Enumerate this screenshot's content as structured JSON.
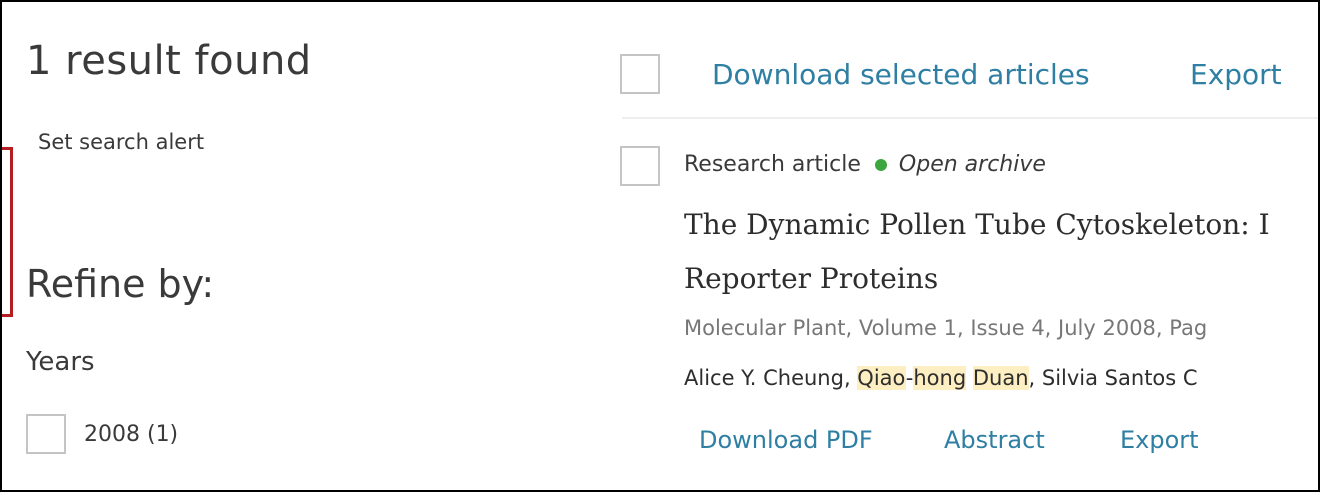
{
  "results": {
    "title": "1 result found",
    "set_alert": "Set search alert"
  },
  "refine": {
    "title": "Refine by:",
    "years_label": "Years",
    "year_option": "2008 (1)"
  },
  "toolbar": {
    "download_selected": "Download selected articles",
    "export": "Export"
  },
  "article": {
    "type": "Research article",
    "access": "Open archive",
    "title_line1": "The Dynamic Pollen Tube Cytoskeleton: I",
    "title_line2": "Reporter Proteins",
    "source": "Molecular Plant, Volume 1, Issue 4, July 2008, Pag",
    "authors": {
      "a1": "Alice Y. Cheung, ",
      "a2_first": "Qiao",
      "a2_sep": "-",
      "a2_mid": "hong",
      "a2_space": " ",
      "a2_last": "Duan",
      "a3": ", Silvia Santos C"
    },
    "actions": {
      "download_pdf": "Download PDF",
      "abstract": "Abstract",
      "export": "Export"
    }
  },
  "colors": {
    "link": "#2e7fa3",
    "open_access_dot": "#3ea63e",
    "highlight": "#fdefc2",
    "marker": "#b41e23"
  }
}
